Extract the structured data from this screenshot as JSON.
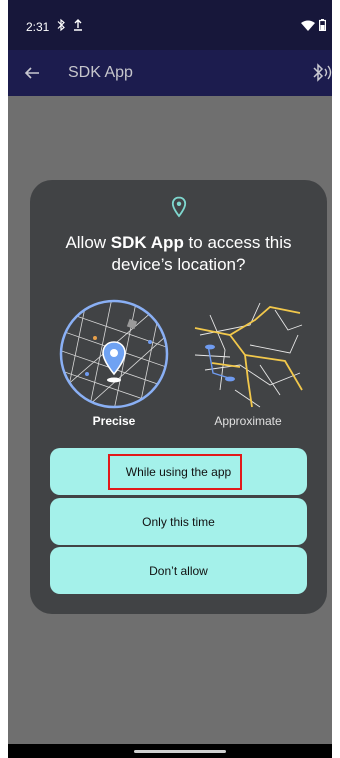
{
  "status_bar": {
    "time": "2:31",
    "icons": [
      "bluetooth-icon",
      "upload-icon",
      "wifi-icon",
      "battery-icon"
    ]
  },
  "app_bar": {
    "title": "SDK App",
    "back_icon": "arrow-left-icon",
    "action_icon": "bluetooth-connected-icon"
  },
  "dialog": {
    "title_prefix": "Allow ",
    "app_name": "SDK App",
    "title_suffix": " to access this device’s location?",
    "options": {
      "precise_label": "Precise",
      "approximate_label": "Approximate",
      "selected": "Precise"
    },
    "buttons": {
      "while_using": "While using the app",
      "only_this_time": "Only this time",
      "dont_allow": "Don’t allow"
    }
  },
  "colors": {
    "status_bar": "#17173a",
    "app_bar": "#1c1c4e",
    "scrim": "#6f6f6f",
    "dialog": "#414345",
    "button": "#a4f1ea",
    "accent_teal": "#7fd8cf",
    "highlight": "#e21a1a"
  }
}
